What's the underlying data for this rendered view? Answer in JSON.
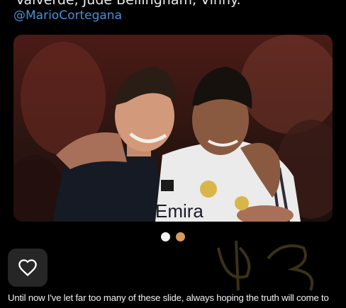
{
  "post": {
    "partial_line": "Valverde, Jude Bellingham, Vinny.",
    "handle": "@MarioCortegana",
    "photo_text": "Emira"
  },
  "carousel": {
    "count": 2,
    "active_index": 0,
    "colors": {
      "active": "#f2f2f2",
      "inactive": "#d99b58"
    }
  },
  "actions": {
    "like_icon": "heart-icon"
  },
  "caption": {
    "text": "Until now I've let far too many of these slide, always hoping the truth will come to"
  },
  "colors": {
    "background": "#000000",
    "handle": "#4a90d9",
    "text": "#f0f0f0"
  }
}
